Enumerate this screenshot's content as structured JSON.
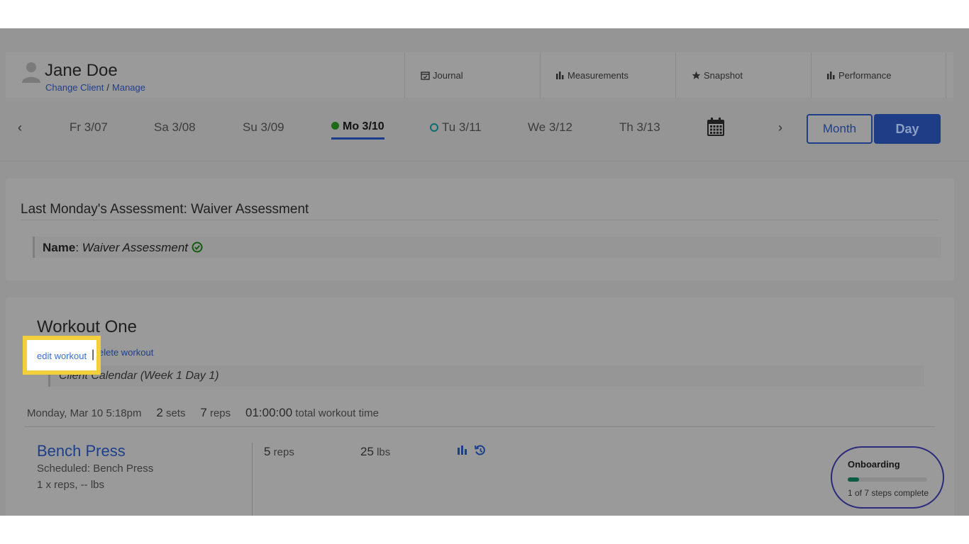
{
  "client": {
    "name": "Jane Doe",
    "change_client": "Change Client",
    "separator": "/",
    "manage": "Manage"
  },
  "tabs": [
    {
      "label": "Journal",
      "icon": "calendar-check-icon"
    },
    {
      "label": "Measurements",
      "icon": "bar-chart-icon"
    },
    {
      "label": "Snapshot",
      "icon": "star-icon"
    },
    {
      "label": "Performance",
      "icon": "bar-chart-icon"
    }
  ],
  "daynav": {
    "prev": "‹",
    "next": "›",
    "days": [
      "Fr 3/07",
      "Sa 3/08",
      "Su 3/09",
      "Mo 3/10",
      "Tu 3/11",
      "We 3/12",
      "Th 3/13"
    ],
    "active_day": "Mo 3/10",
    "month_label": "Month",
    "day_label": "Day"
  },
  "assessment": {
    "title": "Last Monday's Assessment: Waiver Assessment",
    "name_label": "Name",
    "name_value": "Waiver Assessment"
  },
  "workout": {
    "title": "Workout One",
    "edit_label": "edit workout",
    "divider": "|",
    "delete_label": "elete workout",
    "program": "Client Calendar (Week 1 Day 1)",
    "date": "Monday, Mar 10 5:18pm",
    "sets_count": "2",
    "sets_label": "sets",
    "reps_count": "7",
    "reps_label": "reps",
    "time": "01:00:00",
    "time_label": "total workout time"
  },
  "exercise": {
    "name": "Bench Press",
    "scheduled": "Scheduled: Bench Press",
    "target": "1 x reps, -- lbs",
    "reps_value": "5",
    "reps_label": "reps",
    "weight_value": "25",
    "weight_label": "lbs"
  },
  "onboarding": {
    "title": "Onboarding",
    "steps": "1 of 7 steps complete",
    "progress": 0.143
  },
  "colors": {
    "accent": "#1d3f8a",
    "highlight": "#f2d03b",
    "active_dot": "#1e6a17"
  }
}
